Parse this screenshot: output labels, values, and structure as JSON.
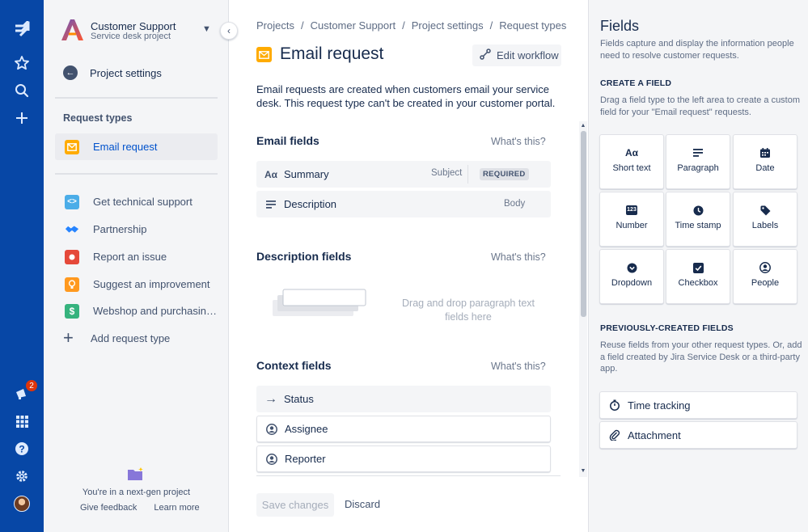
{
  "global_nav": {
    "notifications_count": "2"
  },
  "project": {
    "name": "Customer Support",
    "type": "Service desk project"
  },
  "sidebar": {
    "back_label": "Project settings",
    "request_types_heading": "Request types",
    "selected_item": {
      "label": "Email request",
      "color": "#ffab00"
    },
    "items": [
      {
        "label": "Get technical support",
        "color": "#4bade8",
        "icon": "code-icon"
      },
      {
        "label": "Partnership",
        "color": "#2684ff",
        "icon": "handshake-icon"
      },
      {
        "label": "Report an issue",
        "color": "#e5493a",
        "icon": "alert-icon"
      },
      {
        "label": "Suggest an improvement",
        "color": "#ff991f",
        "icon": "lightbulb-icon"
      },
      {
        "label": "Webshop and purchasin…",
        "color": "#36b37e",
        "icon": "dollar-icon"
      }
    ],
    "add_label": "Add request type",
    "nextgen_text": "You're in a next-gen project",
    "give_feedback": "Give feedback",
    "learn_more": "Learn more"
  },
  "breadcrumb": [
    "Projects",
    "Customer Support",
    "Project settings",
    "Request types"
  ],
  "page": {
    "title": "Email request",
    "edit_workflow": "Edit workflow",
    "description": "Email requests are created when customers email your service desk. This request type can't be created in your customer portal."
  },
  "email_fields": {
    "title": "Email fields",
    "whats_this": "What's this?",
    "rows": [
      {
        "label": "Summary",
        "meta": "Subject",
        "badge": "REQUIRED"
      },
      {
        "label": "Description",
        "meta": "Body"
      }
    ]
  },
  "description_fields": {
    "title": "Description fields",
    "whats_this": "What's this?",
    "drop_hint": "Drag and drop paragraph text fields here"
  },
  "context_fields": {
    "title": "Context fields",
    "whats_this": "What's this?",
    "rows": [
      "Status",
      "Assignee",
      "Reporter"
    ]
  },
  "actions": {
    "save": "Save changes",
    "discard": "Discard"
  },
  "fields_panel": {
    "title": "Fields",
    "description": "Fields capture and display the information people need to resolve customer requests.",
    "create_heading": "CREATE A FIELD",
    "create_description": "Drag a field type to the left area to create a custom field for your \"Email request\" requests.",
    "field_types": [
      {
        "label": "Short text",
        "icon": "short-text-icon",
        "glyph": "Aα"
      },
      {
        "label": "Paragraph",
        "icon": "paragraph-icon",
        "glyph": ""
      },
      {
        "label": "Date",
        "icon": "calendar-icon",
        "glyph": ""
      },
      {
        "label": "Number",
        "icon": "number-icon",
        "glyph": "123"
      },
      {
        "label": "Time stamp",
        "icon": "clock-icon",
        "glyph": ""
      },
      {
        "label": "Labels",
        "icon": "label-icon",
        "glyph": ""
      },
      {
        "label": "Dropdown",
        "icon": "dropdown-icon",
        "glyph": ""
      },
      {
        "label": "Checkbox",
        "icon": "checkbox-icon",
        "glyph": ""
      },
      {
        "label": "People",
        "icon": "person-icon",
        "glyph": ""
      }
    ],
    "previous_heading": "PREVIOUSLY-CREATED FIELDS",
    "previous_description": "Reuse fields from your other request types. Or, add a field created by Jira Service Desk or a third-party app.",
    "previous_fields": [
      {
        "label": "Time tracking",
        "icon": "stopwatch-icon"
      },
      {
        "label": "Attachment",
        "icon": "paperclip-icon"
      }
    ]
  }
}
